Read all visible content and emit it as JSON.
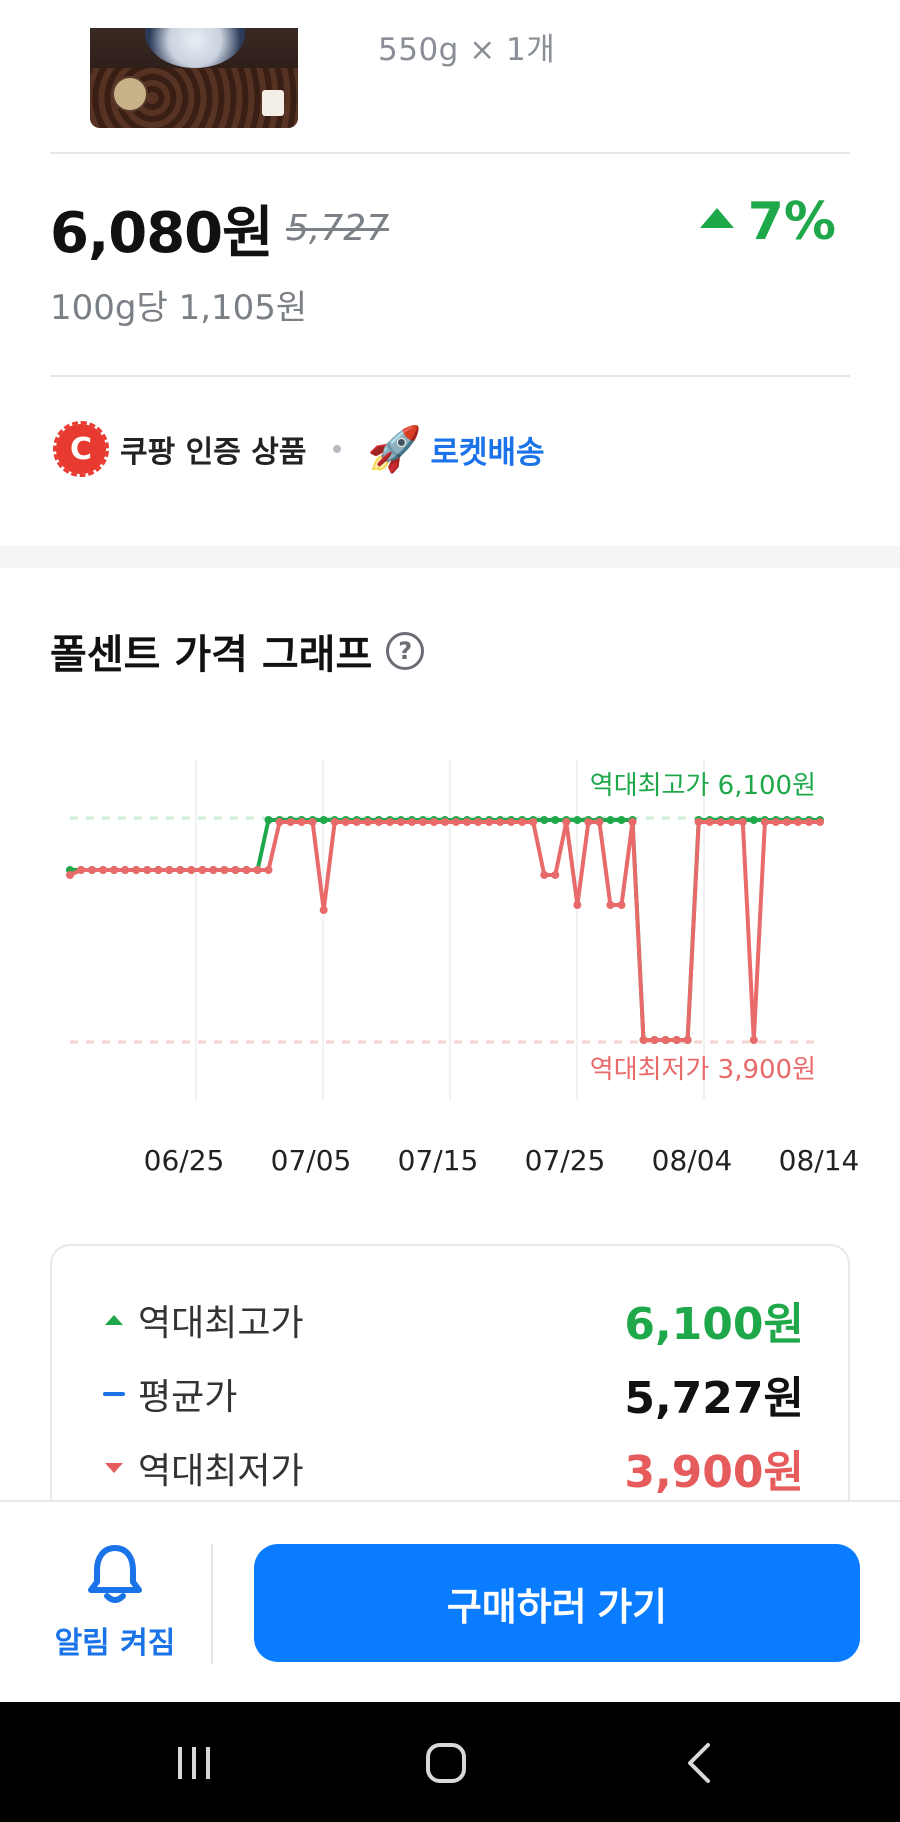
{
  "product": {
    "quantity": "550g × 1개",
    "price_now": "6,080원",
    "price_old": "5,727",
    "change_pct": "7%",
    "per_unit": "100g당 1,105원"
  },
  "badges": {
    "coupang_mark": "C",
    "certified_label": "쿠팡 인증 상품",
    "rocket_label": "로켓배송"
  },
  "graph": {
    "title": "폴센트 가격 그래프",
    "help_glyph": "?"
  },
  "chart_data": {
    "type": "line",
    "x_tick_labels": [
      "06/25",
      "07/05",
      "07/15",
      "07/25",
      "08/04",
      "08/14"
    ],
    "ylim": [
      3900,
      6100
    ],
    "annotations": {
      "max_label": "역대최고가 6,100원",
      "min_label": "역대최저가 3,900원"
    },
    "series": [
      {
        "color": "#1fa84a",
        "values": [
          5600,
          5600,
          5600,
          5600,
          5600,
          5600,
          5600,
          5600,
          5600,
          5600,
          5600,
          5600,
          5600,
          5600,
          5600,
          5600,
          5600,
          5600,
          6100,
          6100,
          6100,
          6100,
          6100,
          6100,
          6100,
          6100,
          6100,
          6100,
          6100,
          6100,
          6100,
          6100,
          6100,
          6100,
          6100,
          6100,
          6100,
          6100,
          6100,
          6100,
          6100,
          6100,
          6100,
          6100,
          6100,
          6100,
          6100,
          6100,
          6100,
          6100,
          6100,
          6100,
          3900,
          3900,
          3900,
          3900,
          3900,
          6100,
          6100,
          6100,
          6100,
          6100,
          6100,
          6100,
          6100,
          6100,
          6100,
          6100,
          6100
        ]
      },
      {
        "color": "#e86a6a",
        "values": [
          5550,
          5600,
          5600,
          5600,
          5600,
          5600,
          5600,
          5600,
          5600,
          5600,
          5600,
          5600,
          5600,
          5600,
          5600,
          5600,
          5600,
          5600,
          5600,
          6080,
          6080,
          6080,
          6080,
          5200,
          6080,
          6080,
          6080,
          6080,
          6080,
          6080,
          6080,
          6080,
          6080,
          6080,
          6080,
          6080,
          6080,
          6080,
          6080,
          6080,
          6080,
          6080,
          6080,
          5550,
          5550,
          6080,
          5250,
          6080,
          6080,
          5250,
          5250,
          6080,
          3900,
          3900,
          3900,
          3900,
          3900,
          6080,
          6080,
          6080,
          6080,
          6080,
          3900,
          6080,
          6080,
          6080,
          6080,
          6080,
          6080
        ]
      }
    ]
  },
  "summary": {
    "max_label": "역대최고가",
    "max_value": "6,100원",
    "avg_label": "평균가",
    "avg_value": "5,727원",
    "min_label": "역대최저가",
    "min_value": "3,900원"
  },
  "bottom": {
    "alarm_label": "알림 켜짐",
    "buy_label": "구매하러 가기"
  },
  "colors": {
    "up": "#1fa84a",
    "down": "#e65b5b",
    "accent": "#0a7cff"
  }
}
